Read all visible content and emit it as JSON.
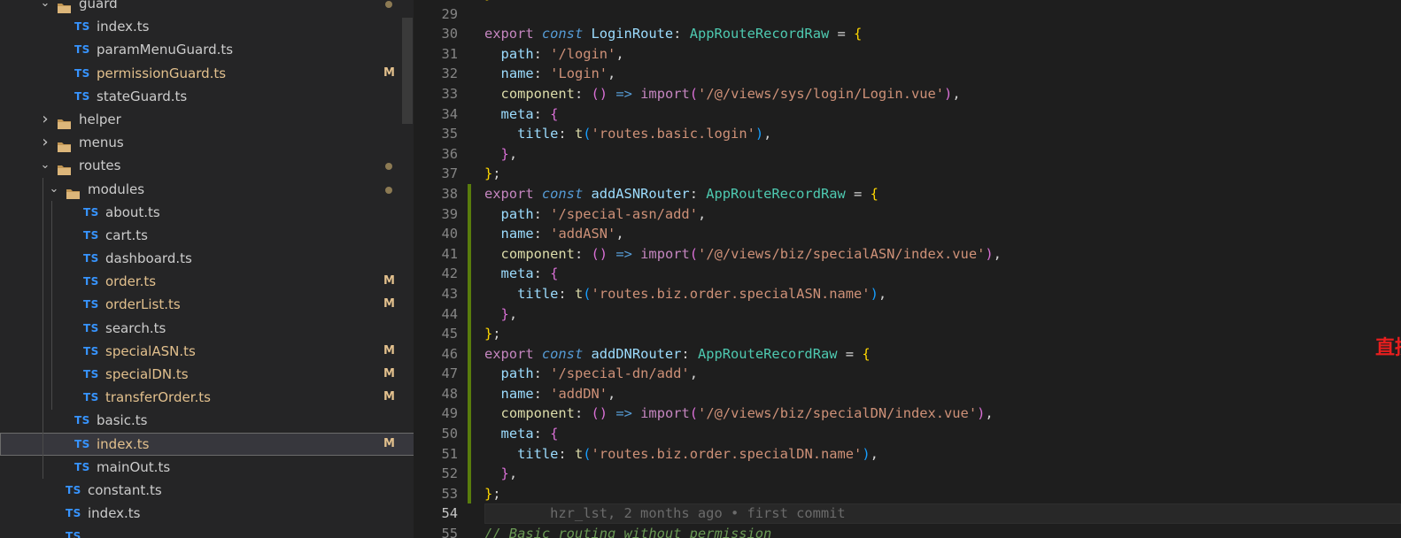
{
  "explorer": {
    "items": [
      {
        "label": "guard",
        "kind": "folder",
        "depth": 1,
        "expanded": true,
        "dot": true
      },
      {
        "label": "index.ts",
        "kind": "ts",
        "depth": 2
      },
      {
        "label": "paramMenuGuard.ts",
        "kind": "ts",
        "depth": 2
      },
      {
        "label": "permissionGuard.ts",
        "kind": "ts",
        "depth": 2,
        "badge": "M"
      },
      {
        "label": "stateGuard.ts",
        "kind": "ts",
        "depth": 2
      },
      {
        "label": "helper",
        "kind": "folder",
        "depth": 1,
        "expanded": false
      },
      {
        "label": "menus",
        "kind": "folder",
        "depth": 1,
        "expanded": false
      },
      {
        "label": "routes",
        "kind": "folder",
        "depth": 1,
        "expanded": true,
        "dot": true
      },
      {
        "label": "modules",
        "kind": "folder",
        "depth": 2,
        "expanded": true,
        "dot": true
      },
      {
        "label": "about.ts",
        "kind": "ts",
        "depth": 3
      },
      {
        "label": "cart.ts",
        "kind": "ts",
        "depth": 3
      },
      {
        "label": "dashboard.ts",
        "kind": "ts",
        "depth": 3
      },
      {
        "label": "order.ts",
        "kind": "ts",
        "depth": 3,
        "badge": "M"
      },
      {
        "label": "orderList.ts",
        "kind": "ts",
        "depth": 3,
        "badge": "M"
      },
      {
        "label": "search.ts",
        "kind": "ts",
        "depth": 3
      },
      {
        "label": "specialASN.ts",
        "kind": "ts",
        "depth": 3,
        "badge": "M"
      },
      {
        "label": "specialDN.ts",
        "kind": "ts",
        "depth": 3,
        "badge": "M"
      },
      {
        "label": "transferOrder.ts",
        "kind": "ts",
        "depth": 3,
        "badge": "M"
      },
      {
        "label": "basic.ts",
        "kind": "ts",
        "depth": 2
      },
      {
        "label": "index.ts",
        "kind": "ts",
        "depth": 2,
        "badge": "M",
        "selected": true
      },
      {
        "label": "mainOut.ts",
        "kind": "ts",
        "depth": 2
      },
      {
        "label": "constant.ts",
        "kind": "ts",
        "depth": 1
      },
      {
        "label": "index.ts",
        "kind": "ts",
        "depth": 1
      },
      {
        "label": "",
        "kind": "ts",
        "depth": 1
      }
    ],
    "file_badge_text": "TS"
  },
  "editor": {
    "lines": [
      {
        "n": "",
        "tokens": [
          [
            "b1",
            "};"
          ]
        ]
      },
      {
        "n": "29",
        "tokens": []
      },
      {
        "n": "30",
        "tokens": [
          [
            "kw",
            "export "
          ],
          [
            "kwi",
            "const "
          ],
          [
            "id",
            "LoginRoute"
          ],
          [
            "op",
            ": "
          ],
          [
            "ty",
            "AppRouteRecordRaw"
          ],
          [
            "op",
            " = "
          ],
          [
            "b1",
            "{"
          ]
        ]
      },
      {
        "n": "31",
        "tokens": [
          [
            "op",
            "  "
          ],
          [
            "pr",
            "path"
          ],
          [
            "op",
            ": "
          ],
          [
            "str",
            "'/login'"
          ],
          [
            "op",
            ","
          ]
        ]
      },
      {
        "n": "32",
        "tokens": [
          [
            "op",
            "  "
          ],
          [
            "pr",
            "name"
          ],
          [
            "op",
            ": "
          ],
          [
            "str",
            "'Login'"
          ],
          [
            "op",
            ","
          ]
        ]
      },
      {
        "n": "33",
        "tokens": [
          [
            "op",
            "  "
          ],
          [
            "fn",
            "component"
          ],
          [
            "op",
            ": "
          ],
          [
            "b2",
            "()"
          ],
          [
            "op",
            " "
          ],
          [
            "kwi",
            "=>"
          ],
          [
            "op",
            " "
          ],
          [
            "kw",
            "import"
          ],
          [
            "b2",
            "("
          ],
          [
            "str",
            "'/@/views/sys/login/Login.vue'"
          ],
          [
            "b2",
            ")"
          ],
          [
            "op",
            ","
          ]
        ]
      },
      {
        "n": "34",
        "tokens": [
          [
            "op",
            "  "
          ],
          [
            "pr",
            "meta"
          ],
          [
            "op",
            ": "
          ],
          [
            "b2",
            "{"
          ]
        ]
      },
      {
        "n": "35",
        "tokens": [
          [
            "op",
            "    "
          ],
          [
            "pr",
            "title"
          ],
          [
            "op",
            ": "
          ],
          [
            "fn",
            "t"
          ],
          [
            "b3",
            "("
          ],
          [
            "str",
            "'routes.basic.login'"
          ],
          [
            "b3",
            ")"
          ],
          [
            "op",
            ","
          ]
        ]
      },
      {
        "n": "36",
        "tokens": [
          [
            "op",
            "  "
          ],
          [
            "b2",
            "}"
          ],
          [
            "op",
            ","
          ]
        ]
      },
      {
        "n": "37",
        "tokens": [
          [
            "b1",
            "}"
          ],
          [
            "op",
            ";"
          ]
        ]
      },
      {
        "n": "38",
        "git": true,
        "tokens": [
          [
            "kw",
            "export "
          ],
          [
            "kwi",
            "const "
          ],
          [
            "id",
            "addASNRouter"
          ],
          [
            "op",
            ": "
          ],
          [
            "ty",
            "AppRouteRecordRaw"
          ],
          [
            "op",
            " = "
          ],
          [
            "b1",
            "{"
          ]
        ]
      },
      {
        "n": "39",
        "git": true,
        "tokens": [
          [
            "op",
            "  "
          ],
          [
            "pr",
            "path"
          ],
          [
            "op",
            ": "
          ],
          [
            "str",
            "'/special-asn/add'"
          ],
          [
            "op",
            ","
          ]
        ]
      },
      {
        "n": "40",
        "git": true,
        "tokens": [
          [
            "op",
            "  "
          ],
          [
            "pr",
            "name"
          ],
          [
            "op",
            ": "
          ],
          [
            "str",
            "'addASN'"
          ],
          [
            "op",
            ","
          ]
        ]
      },
      {
        "n": "41",
        "git": true,
        "tokens": [
          [
            "op",
            "  "
          ],
          [
            "fn",
            "component"
          ],
          [
            "op",
            ": "
          ],
          [
            "b2",
            "()"
          ],
          [
            "op",
            " "
          ],
          [
            "kwi",
            "=>"
          ],
          [
            "op",
            " "
          ],
          [
            "kw",
            "import"
          ],
          [
            "b2",
            "("
          ],
          [
            "str",
            "'/@/views/biz/specialASN/index.vue'"
          ],
          [
            "b2",
            ")"
          ],
          [
            "op",
            ","
          ]
        ]
      },
      {
        "n": "42",
        "git": true,
        "tokens": [
          [
            "op",
            "  "
          ],
          [
            "pr",
            "meta"
          ],
          [
            "op",
            ": "
          ],
          [
            "b2",
            "{"
          ]
        ]
      },
      {
        "n": "43",
        "git": true,
        "tokens": [
          [
            "op",
            "    "
          ],
          [
            "pr",
            "title"
          ],
          [
            "op",
            ": "
          ],
          [
            "fn",
            "t"
          ],
          [
            "b3",
            "("
          ],
          [
            "str",
            "'routes.biz.order.specialASN.name'"
          ],
          [
            "b3",
            ")"
          ],
          [
            "op",
            ","
          ]
        ]
      },
      {
        "n": "44",
        "git": true,
        "tokens": [
          [
            "op",
            "  "
          ],
          [
            "b2",
            "}"
          ],
          [
            "op",
            ","
          ]
        ]
      },
      {
        "n": "45",
        "git": true,
        "tokens": [
          [
            "b1",
            "}"
          ],
          [
            "op",
            ";"
          ]
        ]
      },
      {
        "n": "46",
        "git": true,
        "tokens": [
          [
            "kw",
            "export "
          ],
          [
            "kwi",
            "const "
          ],
          [
            "id",
            "addDNRouter"
          ],
          [
            "op",
            ": "
          ],
          [
            "ty",
            "AppRouteRecordRaw"
          ],
          [
            "op",
            " = "
          ],
          [
            "b1",
            "{"
          ]
        ]
      },
      {
        "n": "47",
        "git": true,
        "tokens": [
          [
            "op",
            "  "
          ],
          [
            "pr",
            "path"
          ],
          [
            "op",
            ": "
          ],
          [
            "str",
            "'/special-dn/add'"
          ],
          [
            "op",
            ","
          ]
        ]
      },
      {
        "n": "48",
        "git": true,
        "tokens": [
          [
            "op",
            "  "
          ],
          [
            "pr",
            "name"
          ],
          [
            "op",
            ": "
          ],
          [
            "str",
            "'addDN'"
          ],
          [
            "op",
            ","
          ]
        ]
      },
      {
        "n": "49",
        "git": true,
        "tokens": [
          [
            "op",
            "  "
          ],
          [
            "fn",
            "component"
          ],
          [
            "op",
            ": "
          ],
          [
            "b2",
            "()"
          ],
          [
            "op",
            " "
          ],
          [
            "kwi",
            "=>"
          ],
          [
            "op",
            " "
          ],
          [
            "kw",
            "import"
          ],
          [
            "b2",
            "("
          ],
          [
            "str",
            "'/@/views/biz/specialDN/index.vue'"
          ],
          [
            "b2",
            ")"
          ],
          [
            "op",
            ","
          ]
        ]
      },
      {
        "n": "50",
        "git": true,
        "tokens": [
          [
            "op",
            "  "
          ],
          [
            "pr",
            "meta"
          ],
          [
            "op",
            ": "
          ],
          [
            "b2",
            "{"
          ]
        ]
      },
      {
        "n": "51",
        "git": true,
        "tokens": [
          [
            "op",
            "    "
          ],
          [
            "pr",
            "title"
          ],
          [
            "op",
            ": "
          ],
          [
            "fn",
            "t"
          ],
          [
            "b3",
            "("
          ],
          [
            "str",
            "'routes.biz.order.specialDN.name'"
          ],
          [
            "b3",
            ")"
          ],
          [
            "op",
            ","
          ]
        ]
      },
      {
        "n": "52",
        "git": true,
        "tokens": [
          [
            "op",
            "  "
          ],
          [
            "b2",
            "}"
          ],
          [
            "op",
            ","
          ]
        ]
      },
      {
        "n": "53",
        "git": true,
        "tokens": [
          [
            "b1",
            "}"
          ],
          [
            "op",
            ";"
          ]
        ]
      },
      {
        "n": "54",
        "current": true,
        "tokens": [
          [
            "blame",
            "        hzr_lst, 2 months ago • first commit"
          ]
        ]
      },
      {
        "n": "55",
        "tokens": [
          [
            "cm",
            "// Basic routing without permission"
          ]
        ]
      }
    ]
  },
  "annotation": {
    "text": "直接进入的页面需要添加静态路由",
    "color": "#e81e1e"
  },
  "colors": {
    "modified": "#e2c08d",
    "ts_badge": "#3794ff",
    "git_added": "#587c0c"
  }
}
